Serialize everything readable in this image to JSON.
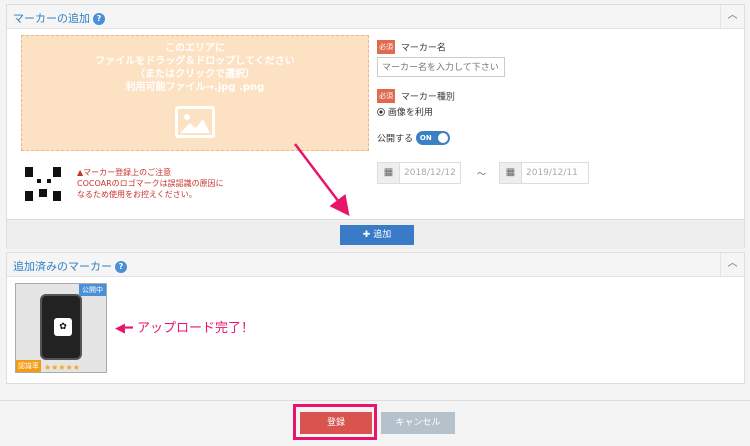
{
  "panel1": {
    "title": "マーカーの追加",
    "dropzone": {
      "line1": "このエリアに",
      "line2": "ファイルをドラッグ＆ドロップしてください",
      "line3": "（またはクリックで選択）",
      "line4": "利用可能ファイル→.jpg .png"
    },
    "marker_name": {
      "required": "必須",
      "label": "マーカー名",
      "placeholder": "マーカー名を入力して下さい"
    },
    "marker_type": {
      "required": "必須",
      "label": "マーカー種別",
      "option": "画像を利用"
    },
    "publish": {
      "label": "公開する",
      "toggle": "ON"
    },
    "dates": {
      "start": "2018/12/12",
      "separator": "～",
      "end": "2019/12/11"
    },
    "notice": {
      "title": "マーカー登録上のご注意",
      "line1": "COCOARのロゴマークは誤認識の原因に",
      "line2": "なるため使用をお控えください。"
    },
    "add_button": "✚ 追加"
  },
  "panel2": {
    "title": "追加済みのマーカー",
    "thumb": {
      "status": "公開中",
      "rating_label": "認識率",
      "stars": "★★★★★"
    }
  },
  "annotation": "アップロード完了！",
  "footer": {
    "register": "登録",
    "cancel": "キャンセル"
  },
  "colors": {
    "accent": "#e8156b",
    "primary": "#3a7bc8",
    "danger": "#d9534f"
  }
}
